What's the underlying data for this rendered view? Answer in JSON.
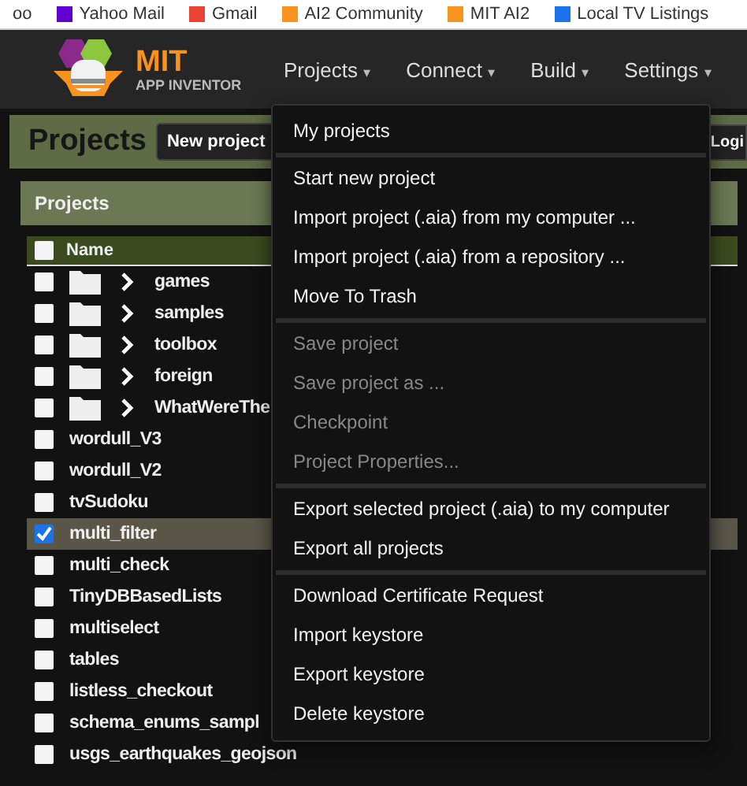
{
  "bookmarks": [
    {
      "label": "oo"
    },
    {
      "label": "Yahoo Mail"
    },
    {
      "label": "Gmail"
    },
    {
      "label": "AI2 Community"
    },
    {
      "label": "MIT AI2"
    },
    {
      "label": "Local TV Listings"
    }
  ],
  "header": {
    "logo_title": "MIT",
    "logo_subtitle": "APP INVENTOR",
    "nav": [
      {
        "label": "Projects",
        "caret": "▾"
      },
      {
        "label": "Connect",
        "caret": "▾"
      },
      {
        "label": "Build",
        "caret": "▾"
      },
      {
        "label": "Settings",
        "caret": "▾"
      }
    ]
  },
  "toolbar": {
    "title": "Projects",
    "buttons": [
      "New project"
    ],
    "login": "Logi"
  },
  "panel": {
    "title": "Projects",
    "column": "Name",
    "all_checked": false,
    "rows": [
      {
        "kind": "folder",
        "name": "games",
        "checked": false,
        "selected": false
      },
      {
        "kind": "folder",
        "name": "samples",
        "checked": false,
        "selected": false
      },
      {
        "kind": "folder",
        "name": "toolbox",
        "checked": false,
        "selected": false
      },
      {
        "kind": "folder",
        "name": "foreign",
        "checked": false,
        "selected": false
      },
      {
        "kind": "folder",
        "name": "WhatWereThe",
        "checked": false,
        "selected": false
      },
      {
        "kind": "project",
        "name": "wordull_V3",
        "checked": false,
        "selected": false
      },
      {
        "kind": "project",
        "name": "wordull_V2",
        "checked": false,
        "selected": false
      },
      {
        "kind": "project",
        "name": "tvSudoku",
        "checked": false,
        "selected": false
      },
      {
        "kind": "project",
        "name": "multi_filter",
        "checked": true,
        "selected": true
      },
      {
        "kind": "project",
        "name": "multi_check",
        "checked": false,
        "selected": false
      },
      {
        "kind": "project",
        "name": "TinyDBBasedLists",
        "checked": false,
        "selected": false
      },
      {
        "kind": "project",
        "name": "multiselect",
        "checked": false,
        "selected": false
      },
      {
        "kind": "project",
        "name": "tables",
        "checked": false,
        "selected": false
      },
      {
        "kind": "project",
        "name": "listless_checkout",
        "checked": false,
        "selected": false
      },
      {
        "kind": "project",
        "name": "schema_enums_sampl",
        "checked": false,
        "selected": false
      },
      {
        "kind": "project",
        "name": "usgs_earthquakes_geojson",
        "checked": false,
        "selected": false
      }
    ]
  },
  "menu": {
    "sections": [
      [
        {
          "label": "My projects",
          "disabled": false
        }
      ],
      [
        {
          "label": "Start new project",
          "disabled": false
        },
        {
          "label": "Import project (.aia) from my computer ...",
          "disabled": false
        },
        {
          "label": "Import project (.aia) from a repository ...",
          "disabled": false
        },
        {
          "label": "Move To Trash",
          "disabled": false
        }
      ],
      [
        {
          "label": "Save project",
          "disabled": true
        },
        {
          "label": "Save project as ...",
          "disabled": true
        },
        {
          "label": "Checkpoint",
          "disabled": true
        },
        {
          "label": "Project Properties...",
          "disabled": true
        }
      ],
      [
        {
          "label": "Export selected project (.aia) to my computer",
          "disabled": false
        },
        {
          "label": "Export all projects",
          "disabled": false
        }
      ],
      [
        {
          "label": "Download Certificate Request",
          "disabled": false
        },
        {
          "label": "Import keystore",
          "disabled": false
        },
        {
          "label": "Export keystore",
          "disabled": false
        },
        {
          "label": "Delete keystore",
          "disabled": false
        }
      ]
    ]
  }
}
